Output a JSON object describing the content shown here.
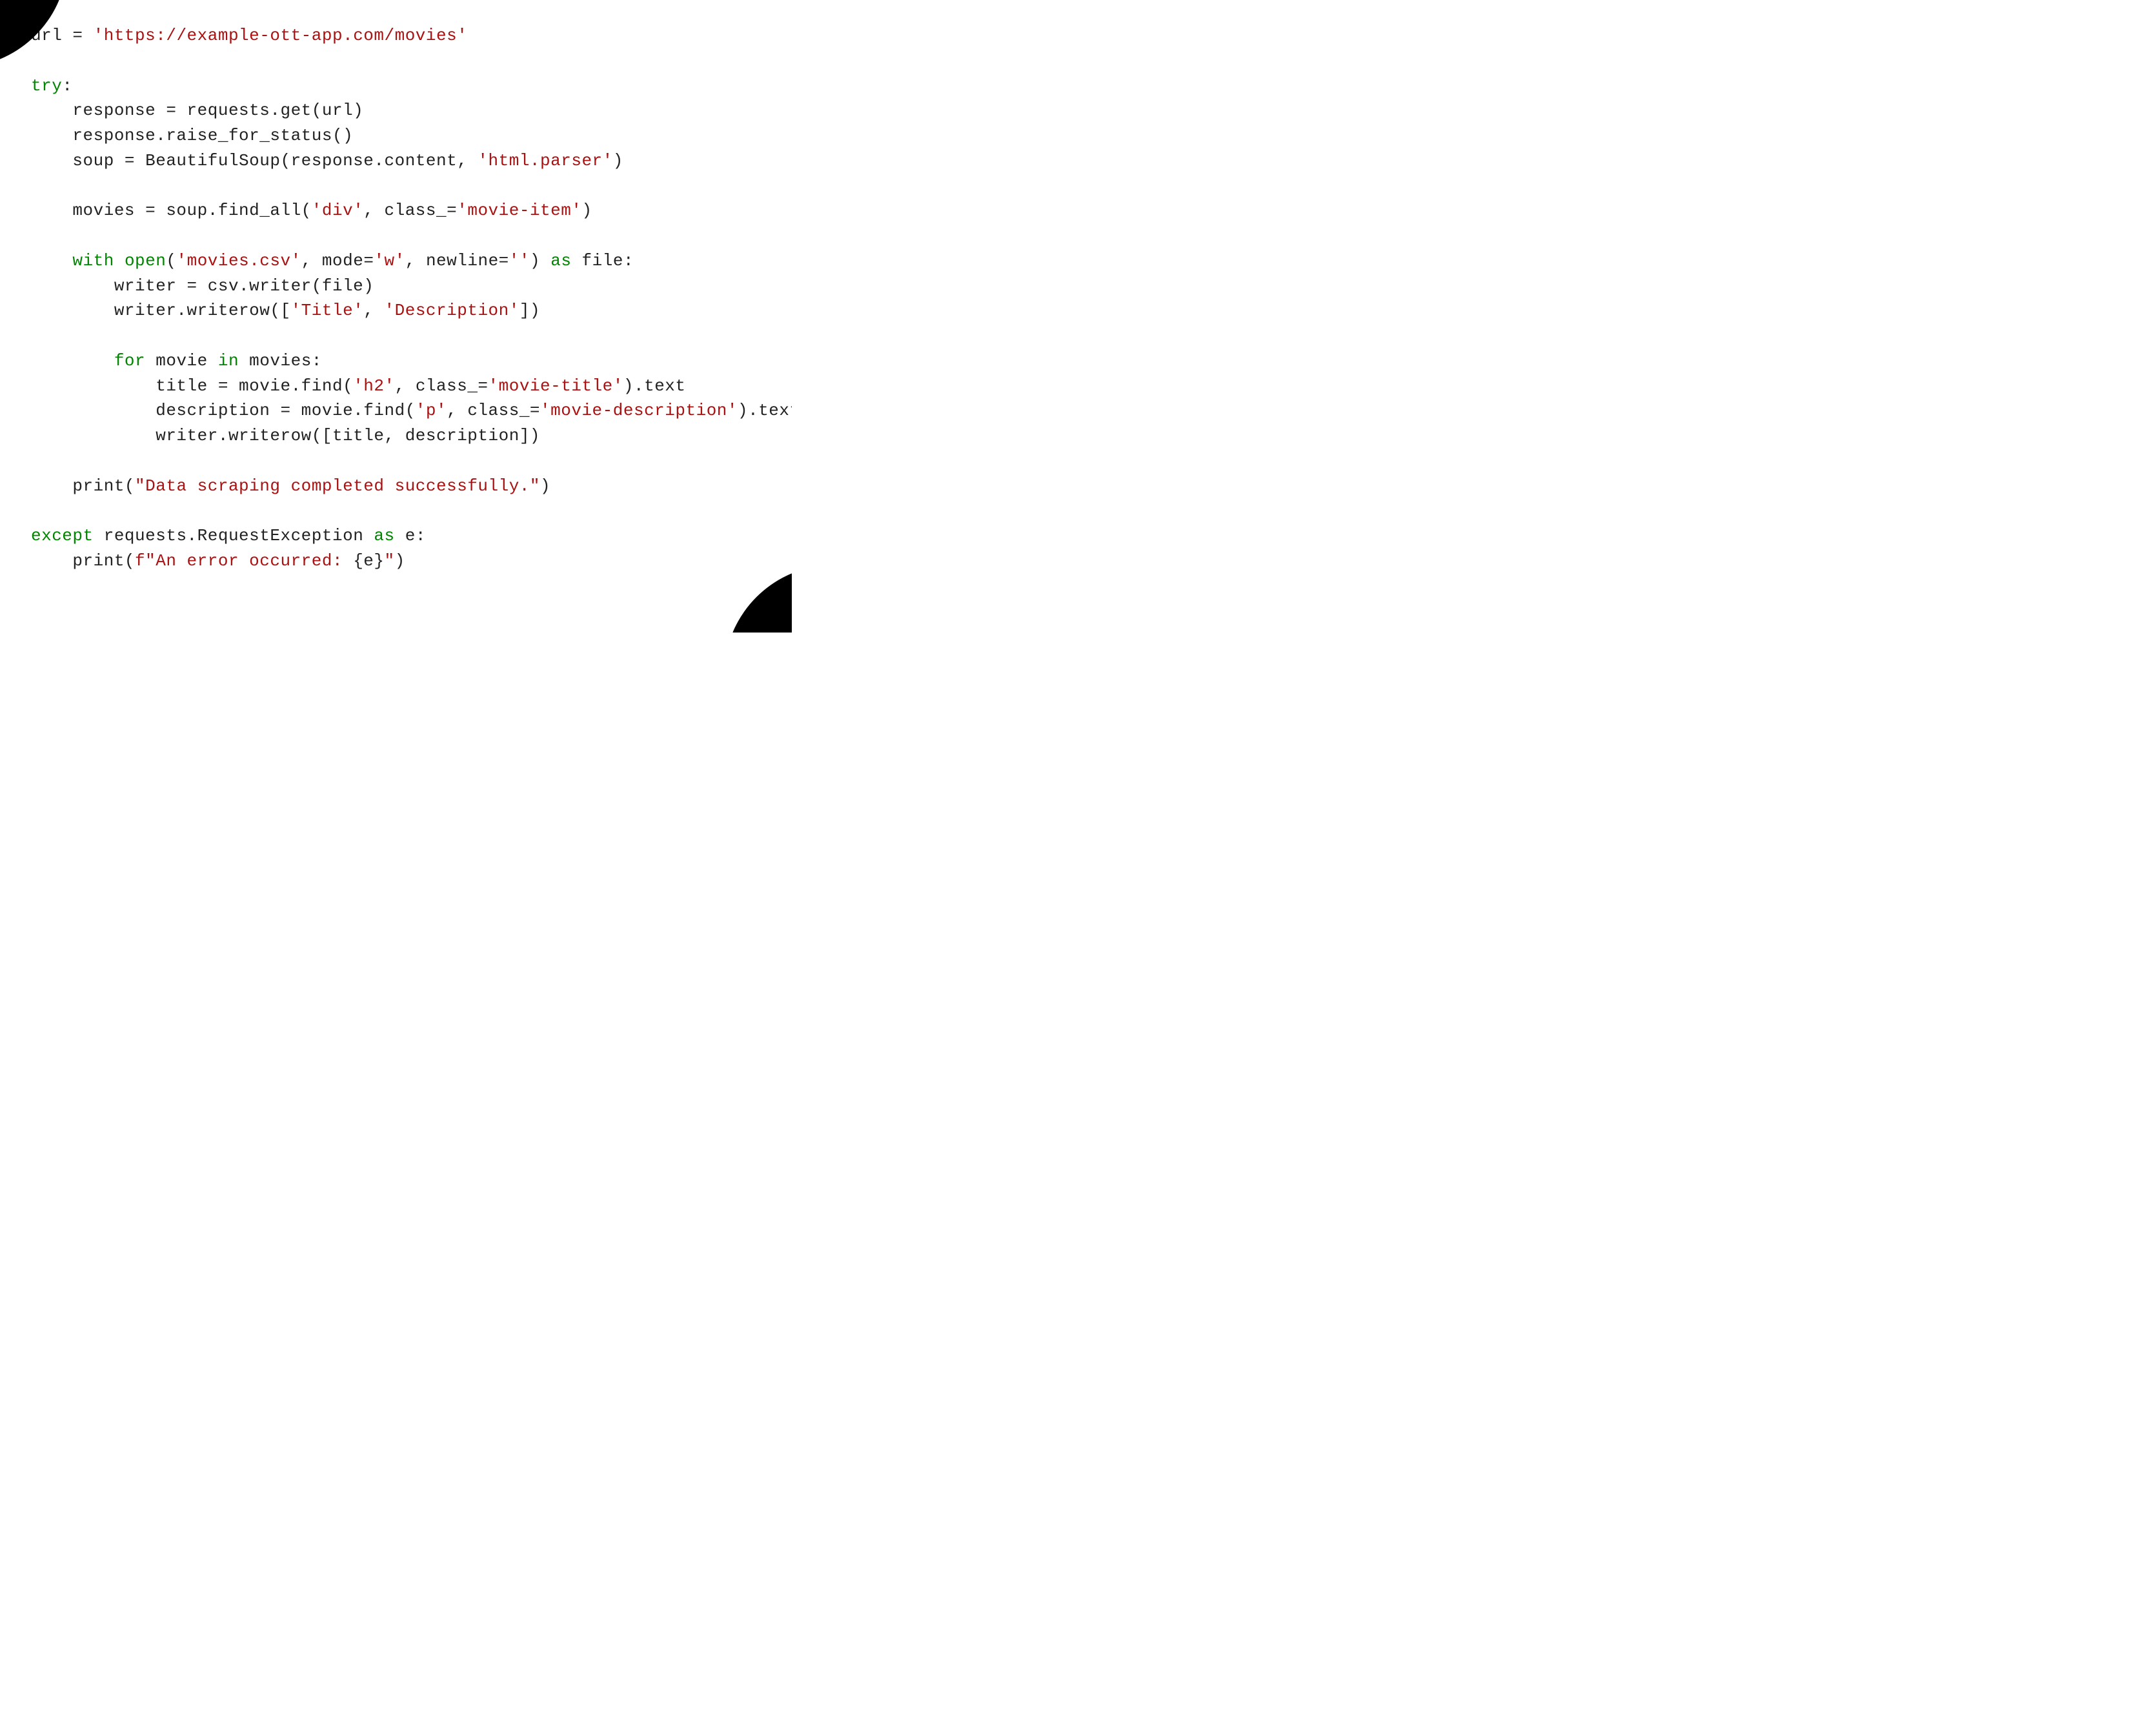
{
  "code": {
    "tokens": [
      [
        [
          "t-default",
          "url = "
        ],
        [
          "t-string",
          "'https://example-ott-app.com/movies'"
        ]
      ],
      [],
      [
        [
          "t-keyword",
          "try"
        ],
        [
          "t-default",
          ":"
        ]
      ],
      [
        [
          "t-default",
          "    response = requests.get(url)"
        ]
      ],
      [
        [
          "t-default",
          "    response.raise_for_status()"
        ]
      ],
      [
        [
          "t-default",
          "    soup = BeautifulSoup(response.content, "
        ],
        [
          "t-string",
          "'html.parser'"
        ],
        [
          "t-default",
          ")"
        ]
      ],
      [],
      [
        [
          "t-default",
          "    movies = soup.find_all("
        ],
        [
          "t-string",
          "'div'"
        ],
        [
          "t-default",
          ", class_="
        ],
        [
          "t-string",
          "'movie-item'"
        ],
        [
          "t-default",
          ")"
        ]
      ],
      [],
      [
        [
          "t-default",
          "    "
        ],
        [
          "t-keyword",
          "with"
        ],
        [
          "t-default",
          " "
        ],
        [
          "t-keyword",
          "open"
        ],
        [
          "t-default",
          "("
        ],
        [
          "t-string",
          "'movies.csv'"
        ],
        [
          "t-default",
          ", mode="
        ],
        [
          "t-string",
          "'w'"
        ],
        [
          "t-default",
          ", newline="
        ],
        [
          "t-string",
          "''"
        ],
        [
          "t-default",
          ") "
        ],
        [
          "t-keyword",
          "as"
        ],
        [
          "t-default",
          " file:"
        ]
      ],
      [
        [
          "t-default",
          "        writer = csv.writer(file)"
        ]
      ],
      [
        [
          "t-default",
          "        writer.writerow(["
        ],
        [
          "t-string",
          "'Title'"
        ],
        [
          "t-default",
          ", "
        ],
        [
          "t-string",
          "'Description'"
        ],
        [
          "t-default",
          "])"
        ]
      ],
      [],
      [
        [
          "t-default",
          "        "
        ],
        [
          "t-keyword",
          "for"
        ],
        [
          "t-default",
          " movie "
        ],
        [
          "t-keyword",
          "in"
        ],
        [
          "t-default",
          " movies:"
        ]
      ],
      [
        [
          "t-default",
          "            title = movie.find("
        ],
        [
          "t-string",
          "'h2'"
        ],
        [
          "t-default",
          ", class_="
        ],
        [
          "t-string",
          "'movie-title'"
        ],
        [
          "t-default",
          ").text"
        ]
      ],
      [
        [
          "t-default",
          "            description = movie.find("
        ],
        [
          "t-string",
          "'p'"
        ],
        [
          "t-default",
          ", class_="
        ],
        [
          "t-string",
          "'movie-description'"
        ],
        [
          "t-default",
          ").text"
        ]
      ],
      [
        [
          "t-default",
          "            writer.writerow([title, description])"
        ]
      ],
      [],
      [
        [
          "t-default",
          "    print("
        ],
        [
          "t-string",
          "\"Data scraping completed successfully.\""
        ],
        [
          "t-default",
          ")"
        ]
      ],
      [],
      [
        [
          "t-keyword",
          "except"
        ],
        [
          "t-default",
          " requests.RequestException "
        ],
        [
          "t-keyword",
          "as"
        ],
        [
          "t-default",
          " e:"
        ]
      ],
      [
        [
          "t-default",
          "    print("
        ],
        [
          "t-fstring",
          "f\"An error occurred: "
        ],
        [
          "t-fexpr",
          "{e}"
        ],
        [
          "t-fstring",
          "\""
        ],
        [
          "t-default",
          ")"
        ]
      ]
    ]
  }
}
